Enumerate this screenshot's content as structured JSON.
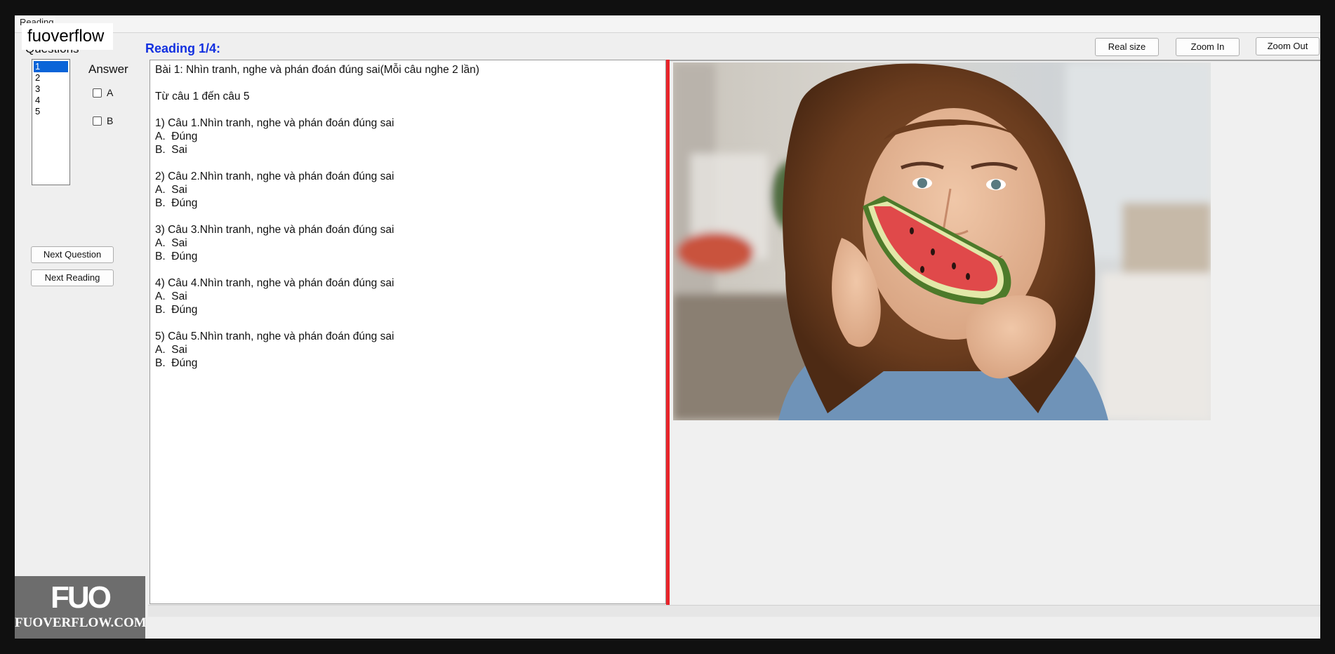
{
  "tab": {
    "label": "Reading"
  },
  "watermark_top": "fuoverflow",
  "sidebar": {
    "questions_label": "Questions",
    "question_numbers": [
      "1",
      "2",
      "3",
      "4",
      "5"
    ],
    "selected_question": "1",
    "answer_label": "Answer",
    "answer_options": [
      "A",
      "B"
    ],
    "next_question_label": "Next Question",
    "next_reading_label": "Next Reading"
  },
  "reading": {
    "title": "Reading 1/4:",
    "paragraphs": [
      "Bài 1: Nhìn tranh, nghe và phán đoán đúng sai(Mỗi câu nghe 2 lần)",
      "Từ câu 1 đến câu 5",
      "1) Câu 1.Nhìn tranh, nghe và phán đoán đúng sai\nA.  Đúng\nB.  Sai",
      "2) Câu 2.Nhìn tranh, nghe và phán đoán đúng sai\nA.  Sai\nB.  Đúng",
      "3) Câu 3.Nhìn tranh, nghe và phán đoán đúng sai\nA.  Sai\nB.  Đúng",
      "4) Câu 4.Nhìn tranh, nghe và phán đoán đúng sai\nA.  Sai\nB.  Đúng",
      "5) Câu 5.Nhìn tranh, nghe và phán đoán đúng sai\nA.  Sai\nB.  Đúng"
    ]
  },
  "image_toolbar": {
    "real_size": "Real size",
    "zoom_in": "Zoom In",
    "zoom_out": "Zoom Out"
  },
  "watermark_bottom": {
    "logo": "FUO",
    "site": "FUOVERFLOW.COM"
  },
  "colors": {
    "title_blue": "#1230e0",
    "splitter_red": "#e8242a",
    "selection_blue": "#0a64d8"
  }
}
